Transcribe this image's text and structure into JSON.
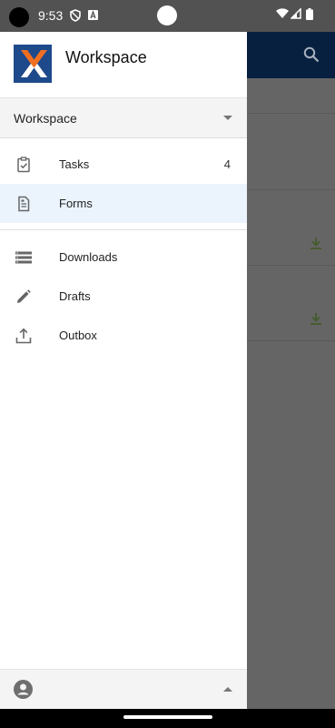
{
  "status": {
    "time": "9:53"
  },
  "app": {
    "title": "Workspace"
  },
  "workspace_selector": {
    "value": "Workspace"
  },
  "nav": {
    "tasks": {
      "label": "Tasks",
      "count": "4"
    },
    "forms": {
      "label": "Forms"
    },
    "downloads": {
      "label": "Downloads"
    },
    "drafts": {
      "label": "Drafts"
    },
    "outbox": {
      "label": "Outbox"
    }
  },
  "colors": {
    "appbar": "#07203f",
    "active_item": "#ebf4fd",
    "logo_blue": "#1e4a8c",
    "logo_orange": "#f26f21"
  }
}
